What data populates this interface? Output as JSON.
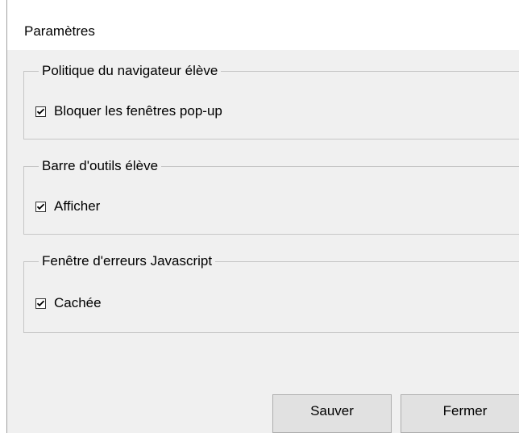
{
  "window": {
    "title": "Paramètres"
  },
  "groups": [
    {
      "legend": "Politique du navigateur élève",
      "option": {
        "label": "Bloquer les fenêtres pop-up",
        "checked": true
      }
    },
    {
      "legend": "Barre d'outils élève",
      "option": {
        "label": "Afficher",
        "checked": true
      }
    },
    {
      "legend": "Fenêtre d'erreurs Javascript",
      "option": {
        "label": "Cachée",
        "checked": true
      }
    }
  ],
  "buttons": {
    "save_label": "Sauver",
    "close_label": "Fermer"
  },
  "colors": {
    "client_background": "#f0f0f0",
    "group_border": "#c6c6c6",
    "button_background": "#e1e1e1",
    "button_border": "#adadad"
  }
}
